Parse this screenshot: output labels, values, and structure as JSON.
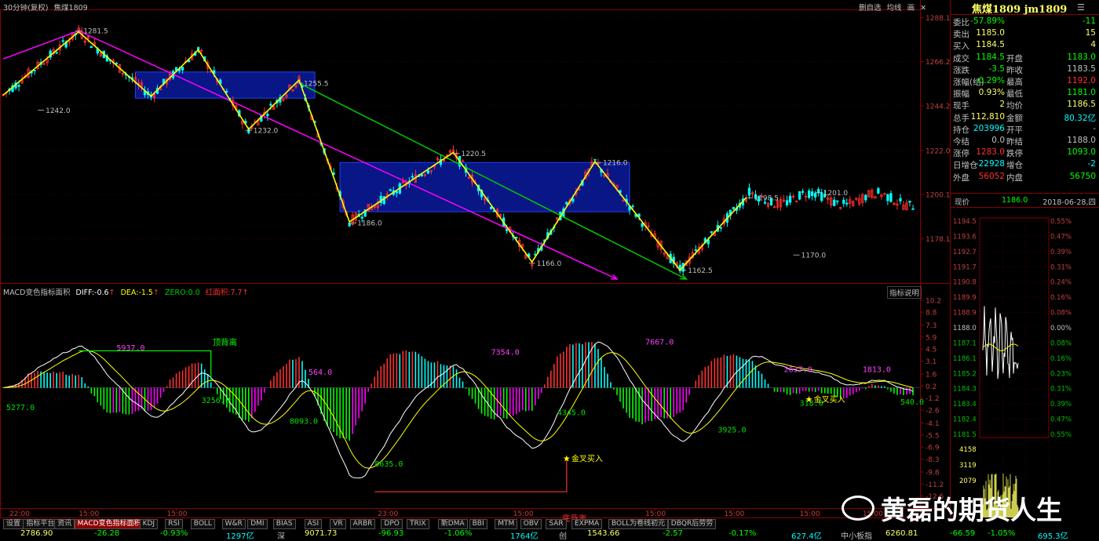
{
  "header": {
    "period": "30分钟(复权)",
    "symbol": "焦煤1809",
    "buttons": [
      "删自选",
      "均线",
      "画"
    ]
  },
  "indicator": {
    "name": "MACD变色指标面积",
    "diff_label": "DIFF:",
    "diff": "-0.6",
    "dea_label": "DEA:",
    "dea": "-1.5",
    "zero_label": "ZERO:",
    "zero": "0.0",
    "area_label": "红面积:",
    "area": "7.7",
    "explain_button": "指标说明"
  },
  "chart_data": {
    "type": "candlestick",
    "price_axis": [
      "1288.1",
      "1266.2",
      "1244.2",
      "1222.0",
      "1200.1",
      "1178.1"
    ],
    "price_range": [
      1158,
      1289
    ],
    "price_labels": [
      {
        "text": "1281.5",
        "index": 23,
        "price": 1281.5
      },
      {
        "text": "1242.0",
        "index": 11,
        "price": 1242.0
      },
      {
        "text": "1255.5",
        "index": 93,
        "price": 1255.5
      },
      {
        "text": "1232.0",
        "index": 77,
        "price": 1232.0
      },
      {
        "text": "1220.5",
        "index": 143,
        "price": 1220.5
      },
      {
        "text": "1186.0",
        "index": 110,
        "price": 1186.0
      },
      {
        "text": "1216.0",
        "index": 188,
        "price": 1216.0
      },
      {
        "text": "1166.0",
        "index": 167,
        "price": 1166.0
      },
      {
        "text": "1162.5",
        "index": 215,
        "price": 1162.5
      },
      {
        "text": "1198.5",
        "index": 236,
        "price": 1198.5
      },
      {
        "text": "1201.0",
        "index": 258,
        "price": 1201.0
      },
      {
        "text": "1170.0",
        "index": 251,
        "price": 1170.0
      }
    ],
    "zigzag": [
      [
        0,
        1249.5
      ],
      [
        24,
        1281.0
      ],
      [
        47,
        1249.0
      ],
      [
        62,
        1272.0
      ],
      [
        78,
        1232.5
      ],
      [
        94,
        1257.0
      ],
      [
        110,
        1186.5
      ],
      [
        143,
        1221.0
      ],
      [
        168,
        1166.5
      ],
      [
        188,
        1216.5
      ],
      [
        215,
        1162.5
      ],
      [
        236,
        1198.5
      ]
    ],
    "zigzag_color": "#ffff00",
    "boxes": [
      {
        "from": 42,
        "to": 99,
        "top": 1261.0,
        "bottom": 1248.0
      },
      {
        "from": 107,
        "to": 199,
        "top": 1216.0,
        "bottom": 1191.5
      }
    ],
    "trendlines": [
      {
        "color": "#ff00ff",
        "points": [
          [
            0,
            1267.5
          ],
          [
            24,
            1281.5
          ],
          [
            195,
            1158.0
          ]
        ]
      },
      {
        "color": "#00cc00",
        "points": [
          [
            94,
            1255.5
          ],
          [
            217,
            1158.0
          ]
        ]
      }
    ],
    "macd_axis": [
      "10.2",
      "8.8",
      "7.3",
      "5.9",
      "4.5",
      "3.1",
      "1.6",
      "0.2",
      "-1.2",
      "-2.6",
      "-4.1",
      "-5.5",
      "-6.9",
      "-8.3",
      "-9.8",
      "-11.2",
      "-12.6"
    ],
    "macd_range": [
      -14.0,
      11.0
    ],
    "macd_annotations": [
      {
        "text": "5277.0",
        "index": 1,
        "value": -2.3,
        "color": "#00e000"
      },
      {
        "text": "5937.0",
        "index": 36,
        "value": 4.6,
        "color": "#ff40ff"
      },
      {
        "text": "3256.0",
        "index": 63,
        "value": -1.5,
        "color": "#00e000"
      },
      {
        "text": "564.0",
        "index": 97,
        "value": 1.8,
        "color": "#ff40ff"
      },
      {
        "text": "8093.0",
        "index": 91,
        "value": -3.9,
        "color": "#00e000"
      },
      {
        "text": "8635.0",
        "index": 118,
        "value": -8.9,
        "color": "#00e000"
      },
      {
        "text": "7354.0",
        "index": 155,
        "value": 4.1,
        "color": "#ff40ff"
      },
      {
        "text": "4345.0",
        "index": 176,
        "value": -2.9,
        "color": "#00e000"
      },
      {
        "text": "7667.0",
        "index": 204,
        "value": 5.3,
        "color": "#ff40ff"
      },
      {
        "text": "3925.0",
        "index": 227,
        "value": -4.9,
        "color": "#00e000"
      },
      {
        "text": "2637.0",
        "index": 248,
        "value": 2.1,
        "color": "#ff40ff"
      },
      {
        "text": "318.0",
        "index": 253,
        "value": -1.8,
        "color": "#00e000"
      },
      {
        "text": "1813.0",
        "index": 273,
        "value": 2.1,
        "color": "#ff40ff"
      },
      {
        "text": "540.0",
        "index": 285,
        "value": -1.7,
        "color": "#00e000"
      }
    ],
    "divergence": [
      {
        "text": "顶背离",
        "color": "#00ff00",
        "kind": "top"
      },
      {
        "text": "底背离",
        "color": "#ff3030",
        "kind": "bottom"
      }
    ],
    "signals": [
      "金叉买入",
      "金叉买入"
    ],
    "time_axis": [
      "22:00",
      "15:00",
      "15:00",
      "23:00",
      "15:00",
      "15:00",
      "15:00",
      "15:00",
      "15:00"
    ]
  },
  "quote": {
    "title": "焦煤1809  jm1809",
    "rows": [
      {
        "l1": "委比",
        "v1": "-57.89%",
        "c1": "#00ff00",
        "l2": "",
        "v2": "-11",
        "c2": "#00ff00"
      },
      {
        "l1": "卖出",
        "v1": "1185.0",
        "c1": "#ffff66",
        "l2": "",
        "v2": "15",
        "c2": "#ffff66"
      },
      {
        "l1": "买入",
        "v1": "1184.5",
        "c1": "#ffff66",
        "l2": "",
        "v2": "4",
        "c2": "#ffff66"
      },
      {
        "l1": "成交",
        "v1": "1184.5",
        "c1": "#00ff00",
        "l2": "开盘",
        "v2": "1183.0",
        "c2": "#00ff00"
      },
      {
        "l1": "涨跌",
        "v1": "-3.5",
        "c1": "#00ff00",
        "l2": "昨收",
        "v2": "1183.5",
        "c2": "#c0c0c0"
      },
      {
        "l1": "涨幅(结)",
        "v1": "-0.29%",
        "c1": "#00ff00",
        "l2": "最高",
        "v2": "1192.0",
        "c2": "#ff3030"
      },
      {
        "l1": "振幅",
        "v1": "0.93%",
        "c1": "#ffff66",
        "l2": "最低",
        "v2": "1181.0",
        "c2": "#00ff00"
      },
      {
        "l1": "现手",
        "v1": "2",
        "c1": "#ffff66",
        "l2": "均价",
        "v2": "1186.5",
        "c2": "#ffff66"
      },
      {
        "l1": "总手",
        "v1": "112,810",
        "c1": "#ffff66",
        "l2": "金额",
        "v2": "80.32亿",
        "c2": "#00ffff"
      },
      {
        "l1": "持仓",
        "v1": "203996",
        "c1": "#00ffff",
        "l2": "开平",
        "v2": "-",
        "c2": "#c0c0c0"
      },
      {
        "l1": "今结",
        "v1": "0.0",
        "c1": "#c0c0c0",
        "l2": "昨结",
        "v2": "1188.0",
        "c2": "#c0c0c0"
      },
      {
        "l1": "涨停",
        "v1": "1283.0",
        "c1": "#ff3030",
        "l2": "跌停",
        "v2": "1093.0",
        "c2": "#00ff00"
      },
      {
        "l1": "日增仓",
        "v1": "-22928",
        "c1": "#00ffff",
        "l2": "增仓",
        "v2": "-2",
        "c2": "#00ffff"
      },
      {
        "l1": "外盘",
        "v1": "56052",
        "c1": "#ff3030",
        "l2": "内盘",
        "v2": "56750",
        "c2": "#00ff00"
      }
    ],
    "now_label": "现价",
    "now_value": "1186.0",
    "date": "2018-06-28,四"
  },
  "intraday": {
    "price_ticks": [
      "1194.5",
      "1193.6",
      "1192.7",
      "1191.7",
      "1190.8",
      "1189.9",
      "1188.9",
      "1188.0",
      "1187.1",
      "1186.1",
      "1185.2",
      "1184.3",
      "1183.4",
      "1182.4",
      "1181.5"
    ],
    "pct_ticks": [
      "0.55%",
      "0.47%",
      "0.39%",
      "0.31%",
      "0.24%",
      "0.16%",
      "0.08%",
      "0.00%",
      "0.08%",
      "0.16%",
      "0.23%",
      "0.31%",
      "0.39%",
      "0.47%",
      "0.55%"
    ],
    "volume_ticks": [
      "4158",
      "3119",
      "2079"
    ]
  },
  "tabs": [
    "设置",
    "指标平台",
    "资讯",
    "MACD变色指标面积",
    "KDJ",
    "RSI",
    "BOLL",
    "W&R",
    "DMI",
    "BIAS",
    "ASI",
    "VR",
    "ARBR",
    "DPO",
    "TRIX",
    "新DMA",
    "BBI",
    "MTM",
    "OBV",
    "SAR",
    "EXPMA",
    "BOLL为卷线初元",
    "DBQR后劳劳"
  ],
  "active_tab": "MACD变色指标面积",
  "status": [
    {
      "text": "2786.90",
      "color": "#ffff66"
    },
    {
      "text": "-26.28",
      "color": "#00ff00"
    },
    {
      "text": "-0.93%",
      "color": "#00ff00"
    },
    {
      "text": "1297亿",
      "color": "#00ffff"
    },
    {
      "text": "深",
      "color": "#c0c0c0"
    },
    {
      "text": "9071.73",
      "color": "#ffff66"
    },
    {
      "text": "-96.93",
      "color": "#00ff00"
    },
    {
      "text": "-1.06%",
      "color": "#00ff00"
    },
    {
      "text": "1764亿",
      "color": "#00ffff"
    },
    {
      "text": "创",
      "color": "#c0c0c0"
    },
    {
      "text": "1543.66",
      "color": "#ffff66"
    },
    {
      "text": "-2.57",
      "color": "#00ff00"
    },
    {
      "text": "-0.17%",
      "color": "#00ff00"
    },
    {
      "text": "627.4亿",
      "color": "#00ffff"
    },
    {
      "text": "中小板指",
      "color": "#c0c0c0"
    },
    {
      "text": "6260.81",
      "color": "#ffff66"
    },
    {
      "text": "-66.59",
      "color": "#00ff00"
    },
    {
      "text": "-1.05%",
      "color": "#00ff00"
    },
    {
      "text": "695.3亿",
      "color": "#00ffff"
    }
  ],
  "watermark": "黄磊的期货人生",
  "colors": {
    "up": "#ff3030",
    "down": "#00ffff",
    "axis": "#8b0000",
    "box": "#0a1a9c"
  }
}
